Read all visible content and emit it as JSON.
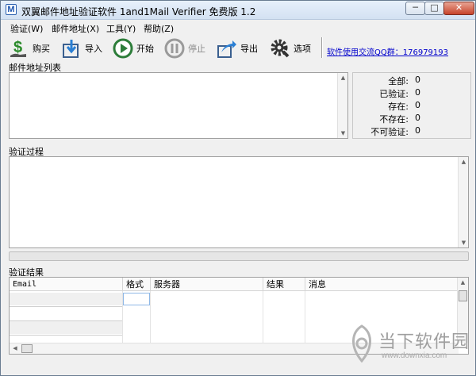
{
  "window": {
    "title": "双翼邮件地址验证软件 1and1Mail Verifier 免费版  1.2",
    "icon_glyph": "M",
    "min_glyph": "─",
    "max_glyph": "□",
    "close_glyph": "✕"
  },
  "menu": [
    {
      "label": "验证(W)"
    },
    {
      "label": "邮件地址(X)"
    },
    {
      "label": "工具(Y)"
    },
    {
      "label": "帮助(Z)"
    }
  ],
  "toolbar": {
    "buy": "购买",
    "import": "导入",
    "start": "开始",
    "stop": "停止",
    "export": "导出",
    "options": "选项",
    "qq_link": "软件使用交流QQ群：176979193"
  },
  "email_list": {
    "label": "邮件地址列表"
  },
  "stats": [
    {
      "label": "全部:",
      "value": "0"
    },
    {
      "label": "已验证:",
      "value": "0"
    },
    {
      "label": "存在:",
      "value": "0"
    },
    {
      "label": "不存在:",
      "value": "0"
    },
    {
      "label": "不可验证:",
      "value": "0"
    }
  ],
  "process": {
    "label": "验证过程"
  },
  "results": {
    "label": "验证结果",
    "columns": [
      "Email",
      "格式",
      "服务器",
      "结果",
      "消息"
    ]
  },
  "watermark": {
    "text": "当下软件园",
    "url": "www.downxia.com"
  },
  "colors": {
    "link": "#0000cc",
    "title_gradient_top": "#e7f0fb",
    "close_button": "#c7432b"
  }
}
